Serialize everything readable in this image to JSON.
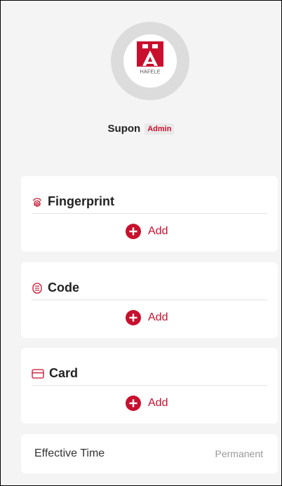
{
  "colors": {
    "accent": "#c8102e",
    "background": "#f4f4f4",
    "card": "#ffffff"
  },
  "profile": {
    "logo_text": "HÄFELE",
    "name": "Supon",
    "role": "Admin"
  },
  "sections": [
    {
      "title": "Fingerprint",
      "icon": "fingerprint-icon",
      "add_label": "Add"
    },
    {
      "title": "Code",
      "icon": "keypad-icon",
      "add_label": "Add"
    },
    {
      "title": "Card",
      "icon": "card-icon",
      "add_label": "Add"
    }
  ],
  "effective_time": {
    "label": "Effective Time",
    "value": "Permanent"
  }
}
